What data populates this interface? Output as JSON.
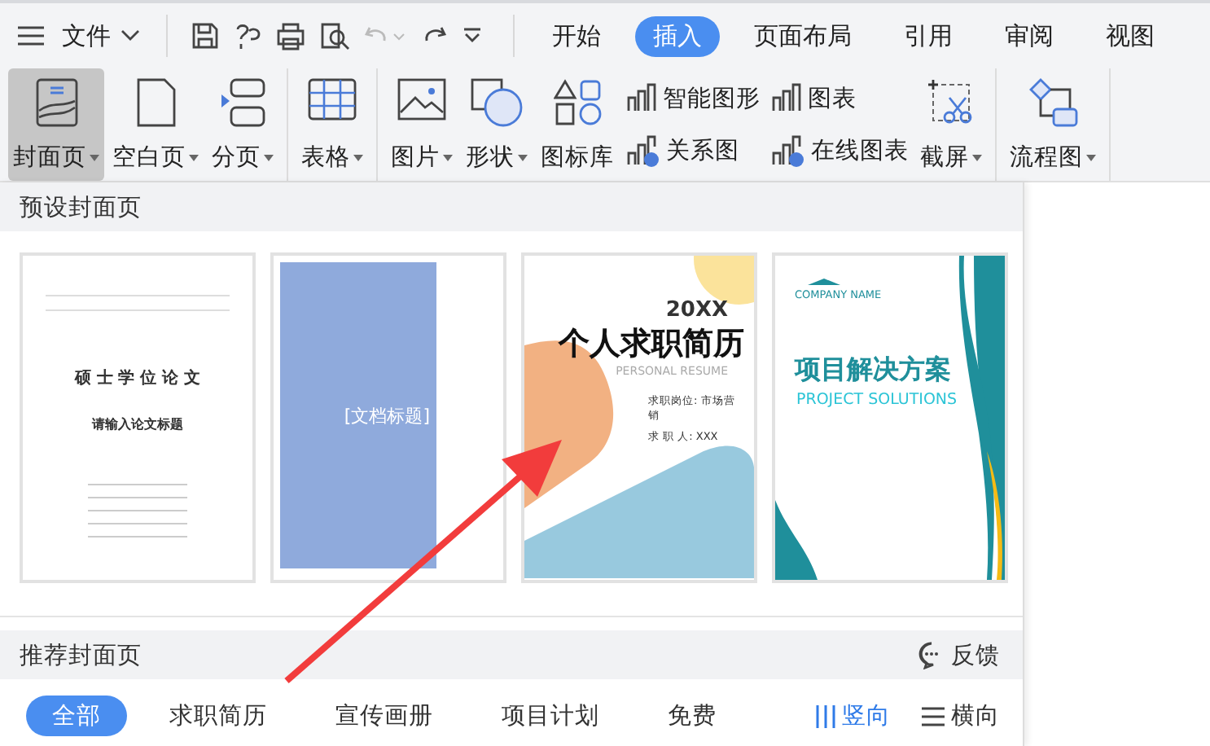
{
  "quick_access": {
    "menu_label": "文件"
  },
  "tabs": [
    {
      "label": "开始",
      "selected": false
    },
    {
      "label": "插入",
      "selected": true
    },
    {
      "label": "页面布局",
      "selected": false
    },
    {
      "label": "引用",
      "selected": false
    },
    {
      "label": "审阅",
      "selected": false
    },
    {
      "label": "视图",
      "selected": false
    }
  ],
  "ribbon": {
    "groups": [
      {
        "items": [
          {
            "kind": "large",
            "label": "封面页",
            "dropdown": true,
            "selected": true
          },
          {
            "kind": "large",
            "label": "空白页",
            "dropdown": true,
            "selected": false
          },
          {
            "kind": "large",
            "label": "分页",
            "dropdown": true,
            "selected": false
          }
        ]
      },
      {
        "items": [
          {
            "kind": "large",
            "label": "表格",
            "dropdown": true,
            "selected": false
          }
        ]
      },
      {
        "items": [
          {
            "kind": "large",
            "label": "图片",
            "dropdown": true,
            "selected": false
          },
          {
            "kind": "large",
            "label": "形状",
            "dropdown": true,
            "selected": false
          },
          {
            "kind": "large",
            "label": "图标库",
            "dropdown": false,
            "selected": false
          },
          {
            "kind": "small",
            "top": "智能图形",
            "bottom": "关系图"
          },
          {
            "kind": "small",
            "top": "图表",
            "bottom": "在线图表"
          },
          {
            "kind": "large",
            "label": "截屏",
            "dropdown": true,
            "selected": false
          }
        ]
      },
      {
        "items": [
          {
            "kind": "large",
            "label": "流程图",
            "dropdown": true,
            "selected": false
          }
        ]
      }
    ]
  },
  "preset_section": {
    "title": "预设封面页",
    "covers": [
      {
        "kind": "thesis",
        "title": "硕 士 学 位 论 文",
        "subtitle": "请输入论文标题"
      },
      {
        "kind": "blue",
        "title": "[文档标题]"
      },
      {
        "kind": "resume",
        "year": "20XX",
        "title": "个人求职简历",
        "subtitle": "PERSONAL RESUME",
        "lines": [
          "求职岗位: 市场营销",
          "求 职 人:  XXX"
        ]
      },
      {
        "kind": "project",
        "company": "COMPANY NAME",
        "title": "项目解决方案",
        "subtitle": "PROJECT SOLUTIONS"
      }
    ]
  },
  "recommended_section": {
    "title": "推荐封面页",
    "feedback": "反馈",
    "filters": [
      {
        "label": "全部",
        "selected": true
      },
      {
        "label": "求职简历",
        "selected": false
      },
      {
        "label": "宣传画册",
        "selected": false
      },
      {
        "label": "项目计划",
        "selected": false
      },
      {
        "label": "免费",
        "selected": false
      }
    ],
    "orientations": [
      {
        "label": "竖向",
        "selected": true
      },
      {
        "label": "横向",
        "selected": false
      }
    ]
  }
}
